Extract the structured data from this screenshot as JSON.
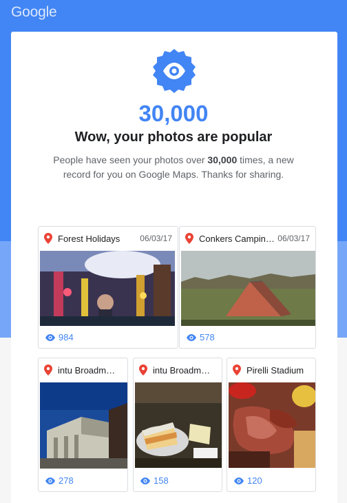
{
  "header": {
    "logo": "Google"
  },
  "hero": {
    "count": "30,000",
    "headline": "Wow, your photos are popular",
    "desc_pre": "People have seen your photos over ",
    "desc_bold": "30,000",
    "desc_post": " times, a new record for you on Google Maps. Thanks for sharing."
  },
  "photos": [
    {
      "title": "Forest Holidays",
      "date": "06/03/17",
      "views": "984"
    },
    {
      "title": "Conkers Campin…",
      "date": "06/03/17",
      "views": "578"
    },
    {
      "title": "intu Broadm…",
      "views": "278"
    },
    {
      "title": "intu Broadm…",
      "views": "158"
    },
    {
      "title": "Pirelli Stadium",
      "views": "120"
    }
  ],
  "colors": {
    "brand_blue": "#4285f4",
    "pin_red": "#ea4335"
  },
  "icons": {
    "badge": "eye-badge-icon",
    "pin": "map-pin-icon",
    "views": "eye-icon"
  }
}
